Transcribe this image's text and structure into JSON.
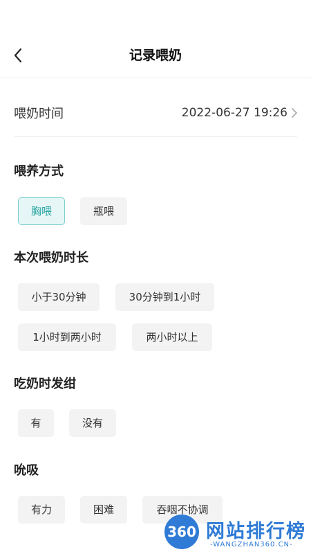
{
  "header": {
    "title": "记录喂奶"
  },
  "feed_time": {
    "label": "喂奶时间",
    "value": "2022-06-27 19:26"
  },
  "feeding_method": {
    "title": "喂养方式",
    "options": [
      "胸喂",
      "瓶喂"
    ],
    "selected": "胸喂"
  },
  "duration": {
    "title": "本次喂奶时长",
    "options": [
      "小于30分钟",
      "30分钟到1小时",
      "1小时到两小时",
      "两小时以上"
    ]
  },
  "cyanosis": {
    "title": "吃奶时发绀",
    "options": [
      "有",
      "没有"
    ]
  },
  "sucking": {
    "title": "吮吸",
    "options": [
      "有力",
      "困难",
      "吞咽不协调"
    ]
  },
  "watermark": {
    "badge": "360",
    "text": "网站排行榜",
    "sub": "-WANGZHAN360.CN-"
  },
  "colors": {
    "accent": "#2aa6a2",
    "selected_bg": "#e6f6f6",
    "chip_bg": "#f3f3f3"
  },
  "icons": {
    "back": "chevron-left-icon",
    "time_arrow": "chevron-right-icon"
  }
}
